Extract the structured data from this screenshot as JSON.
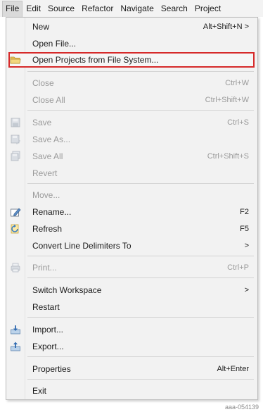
{
  "menubar": {
    "items": [
      "File",
      "Edit",
      "Source",
      "Refactor",
      "Navigate",
      "Search",
      "Project"
    ]
  },
  "menu": {
    "new": {
      "label": "New",
      "shortcut": "Alt+Shift+N >"
    },
    "open_file": {
      "label": "Open File..."
    },
    "open_projects": {
      "label": "Open Projects from File System..."
    },
    "close": {
      "label": "Close",
      "shortcut": "Ctrl+W"
    },
    "close_all": {
      "label": "Close All",
      "shortcut": "Ctrl+Shift+W"
    },
    "save": {
      "label": "Save",
      "shortcut": "Ctrl+S"
    },
    "save_as": {
      "label": "Save As..."
    },
    "save_all": {
      "label": "Save All",
      "shortcut": "Ctrl+Shift+S"
    },
    "revert": {
      "label": "Revert"
    },
    "move": {
      "label": "Move..."
    },
    "rename": {
      "label": "Rename...",
      "shortcut": "F2"
    },
    "refresh": {
      "label": "Refresh",
      "shortcut": "F5"
    },
    "convert": {
      "label": "Convert Line Delimiters To",
      "arrow": ">"
    },
    "print": {
      "label": "Print...",
      "shortcut": "Ctrl+P"
    },
    "switch_workspace": {
      "label": "Switch Workspace",
      "arrow": ">"
    },
    "restart": {
      "label": "Restart"
    },
    "import": {
      "label": "Import..."
    },
    "export": {
      "label": "Export..."
    },
    "properties": {
      "label": "Properties",
      "shortcut": "Alt+Enter"
    },
    "exit": {
      "label": "Exit"
    }
  },
  "icons": {
    "open_projects": "folder-icon",
    "save": "save-icon",
    "save_as": "save-as-icon",
    "save_all": "save-all-icon",
    "rename": "rename-icon",
    "refresh": "refresh-icon",
    "print": "print-icon",
    "import": "import-icon",
    "export": "export-icon"
  },
  "colors": {
    "highlight_border": "#d62a2a",
    "menu_bg": "#f2f2f2",
    "disabled_text": "#9a9a9a"
  },
  "watermark": "aaa-054139"
}
